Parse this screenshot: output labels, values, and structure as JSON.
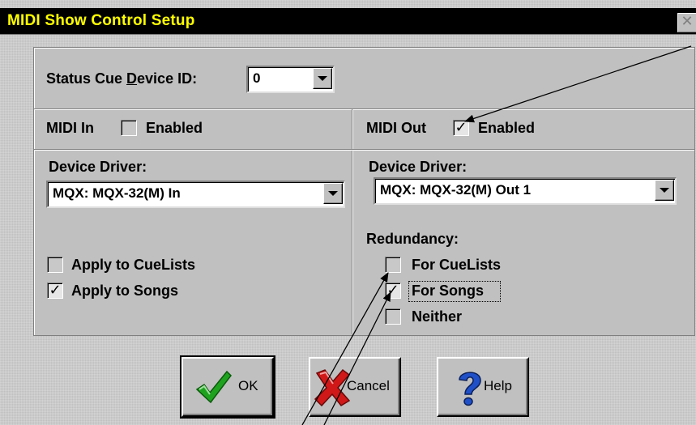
{
  "window": {
    "title": "MIDI Show Control Setup",
    "close_glyph": "✕"
  },
  "status": {
    "label_pre": "Status Cue ",
    "label_mnemonic": "D",
    "label_post": "evice ID:",
    "value": "0"
  },
  "midi_in": {
    "title": "MIDI In",
    "enabled_label": "Enabled",
    "enabled_checked": false,
    "driver_label": "Device Driver:",
    "driver_value": "MQX: MQX-32(M) In",
    "apply_cuelists_label": "Apply to CueLists",
    "apply_cuelists_checked": false,
    "apply_songs_label": "Apply to Songs",
    "apply_songs_checked": true
  },
  "midi_out": {
    "title": "MIDI Out",
    "enabled_label": "Enabled",
    "enabled_checked": true,
    "driver_label": "Device Driver:",
    "driver_value": "MQX: MQX-32(M) Out 1",
    "redundancy_label": "Redundancy:",
    "for_cuelists_label": "For CueLists",
    "for_cuelists_checked": false,
    "for_songs_label": "For Songs",
    "for_songs_checked": true,
    "neither_label": "Neither",
    "neither_checked": false
  },
  "check_glyph": "✓",
  "buttons": {
    "ok": "OK",
    "cancel": "Cancel",
    "help": "Help"
  },
  "icons": {
    "ok": "green-checkmark-icon",
    "cancel": "red-x-icon",
    "help": "blue-question-mark-icon"
  },
  "colors": {
    "title_bg": "#000000",
    "title_text": "#ffff00",
    "dialog_bg": "#c0c0c0",
    "ok_green": "#1fa31f",
    "cancel_red": "#d01818",
    "help_blue": "#2050c8"
  }
}
